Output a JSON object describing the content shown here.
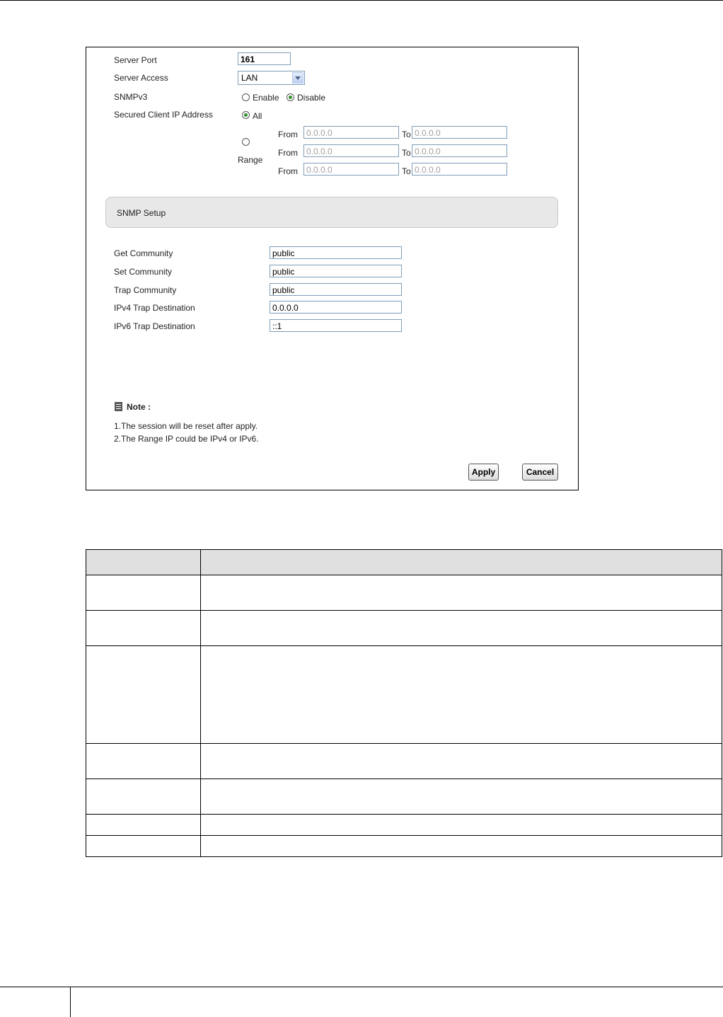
{
  "form": {
    "server_port": {
      "label": "Server Port",
      "value": "161"
    },
    "server_access": {
      "label": "Server Access",
      "value": "LAN"
    },
    "snmpv3": {
      "label": "SNMPv3",
      "enable_label": "Enable",
      "disable_label": "Disable",
      "selected": "Disable"
    },
    "secured_client": {
      "label": "Secured Client IP Address",
      "all_label": "All",
      "range_label": "Range",
      "selected": "All",
      "from_label": "From",
      "to_label": "To",
      "ranges": [
        {
          "from": "0.0.0.0",
          "to": "0.0.0.0"
        },
        {
          "from": "0.0.0.0",
          "to": "0.0.0.0"
        },
        {
          "from": "0.0.0.0",
          "to": "0.0.0.0"
        }
      ]
    },
    "section_title": "SNMP Setup",
    "fields": [
      {
        "label": "Get Community",
        "value": "public"
      },
      {
        "label": "Set Community",
        "value": "public"
      },
      {
        "label": "Trap Community",
        "value": "public"
      },
      {
        "label": "IPv4 Trap Destination",
        "value": "0.0.0.0"
      },
      {
        "label": "IPv6 Trap Destination",
        "value": "::1"
      }
    ],
    "note": {
      "title": "Note :",
      "lines": [
        "1.The session will be reset after apply.",
        "2.The Range IP could be IPv4 or IPv6."
      ]
    },
    "buttons": {
      "apply": "Apply",
      "cancel": "Cancel"
    }
  }
}
